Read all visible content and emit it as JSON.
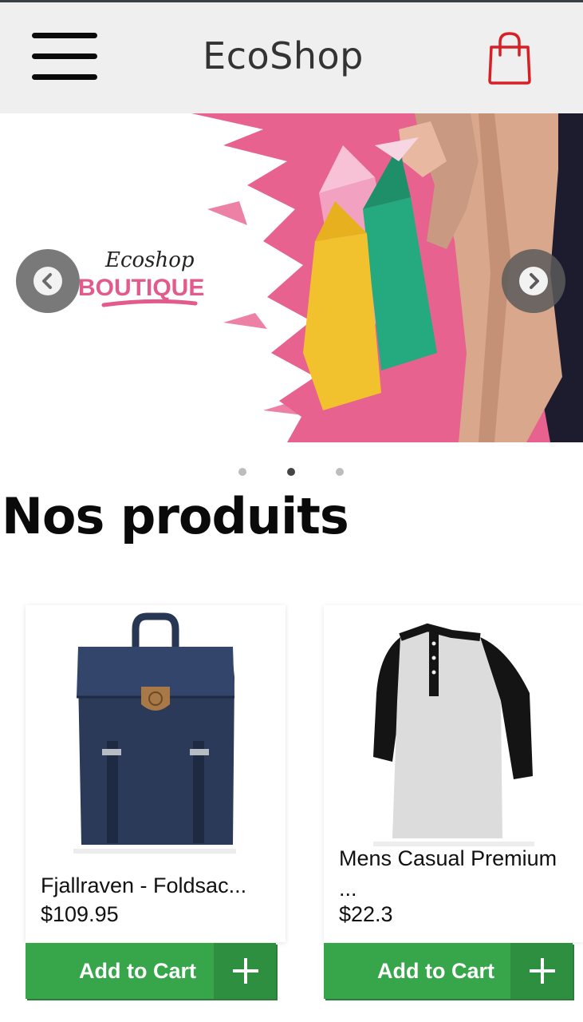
{
  "header": {
    "brand": "EcoShop",
    "menu_icon": "hamburger-menu-icon",
    "cart_icon": "shopping-bag-icon",
    "cart_icon_color": "#d81f26"
  },
  "carousel": {
    "slide_logo_script": "Ecoshop",
    "slide_logo_word": "BOUTIQUE",
    "prev_icon": "chevron-left-icon",
    "next_icon": "chevron-right-icon",
    "slide_count": 3,
    "active_slide": 2,
    "accent_pink": "#e8628f"
  },
  "section": {
    "title": "Nos produits"
  },
  "products": [
    {
      "name": "Fjallraven - Foldsac...",
      "price": "$109.95",
      "image": "navy-backpack"
    },
    {
      "name": "Mens Casual Premium",
      "name_more": "...",
      "price": "$22.3",
      "image": "raglan-henley-shirt"
    }
  ],
  "cart_button": {
    "label": "Add to Cart",
    "icon": "plus-icon",
    "color": "#37a64a"
  }
}
